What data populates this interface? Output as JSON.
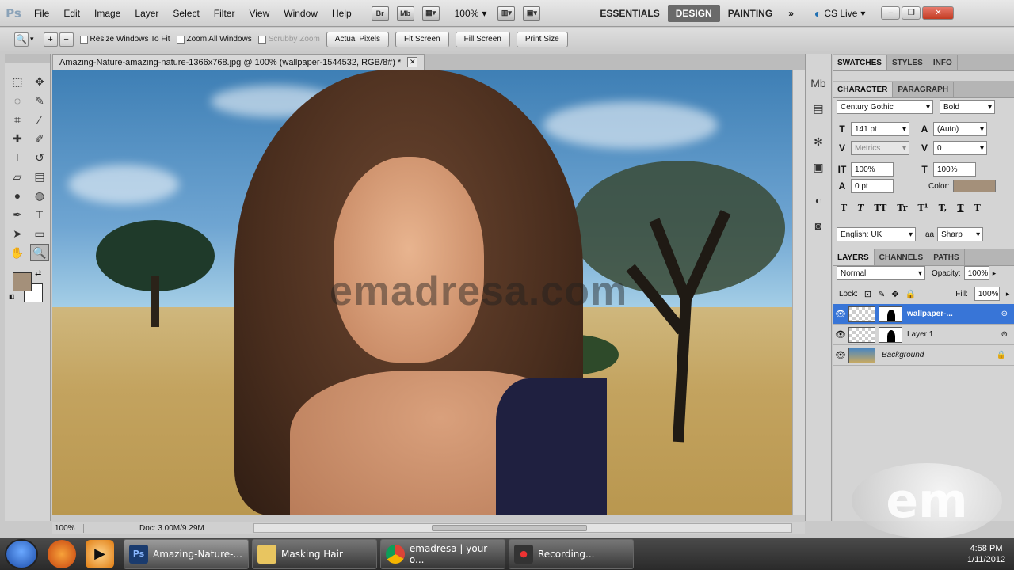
{
  "app": {
    "logo": "Ps"
  },
  "menu": [
    "File",
    "Edit",
    "Image",
    "Layer",
    "Select",
    "Filter",
    "View",
    "Window",
    "Help"
  ],
  "menubar": {
    "br": "Br",
    "mb": "Mb",
    "zoom": "100%"
  },
  "workspaces": {
    "essentials": "ESSENTIALS",
    "design": "DESIGN",
    "painting": "PAINTING",
    "more": "»"
  },
  "cslive": "CS Live",
  "options": {
    "resize_windows": "Resize Windows To Fit",
    "zoom_all": "Zoom All Windows",
    "scrubby": "Scrubby Zoom",
    "actual_pixels": "Actual Pixels",
    "fit_screen": "Fit Screen",
    "fill_screen": "Fill Screen",
    "print_size": "Print Size"
  },
  "document": {
    "tab_title": "Amazing-Nature-amazing-nature-1366x768.jpg @ 100% (wallpaper-1544532, RGB/8#) *",
    "watermark": "emadresa.com",
    "zoom": "100%",
    "doc_info": "Doc: 3.00M/9.29M"
  },
  "panels": {
    "tabs_top": [
      "SWATCHES",
      "STYLES",
      "INFO"
    ],
    "tabs_char": [
      "CHARACTER",
      "PARAGRAPH"
    ],
    "font_family": "Century Gothic",
    "font_style": "Bold",
    "font_size": "141 pt",
    "leading": "(Auto)",
    "kerning": "Metrics",
    "tracking": "0",
    "vscale": "100%",
    "hscale": "100%",
    "baseline": "0 pt",
    "color_label": "Color:",
    "text_color": "#a4907a",
    "language": "English: UK",
    "antialias_icon": "aa",
    "antialias": "Sharp",
    "style_buttons": [
      "T",
      "T",
      "TT",
      "Tr",
      "T¹",
      "T,",
      "T",
      "Ŧ"
    ],
    "tabs_layers": [
      "LAYERS",
      "CHANNELS",
      "PATHS"
    ],
    "blend": "Normal",
    "opacity_label": "Opacity:",
    "opacity": "100%",
    "lock_label": "Lock:",
    "fill_label": "Fill:",
    "fill": "100%",
    "layers": [
      "wallpaper-...",
      "Layer 1",
      "Background"
    ]
  },
  "taskbar": {
    "tasks": [
      "Amazing-Nature-...",
      "Masking Hair",
      "emadresa | your o...",
      "Recording..."
    ],
    "time": "4:58 PM",
    "date": "1/11/2012"
  },
  "badge": "em"
}
